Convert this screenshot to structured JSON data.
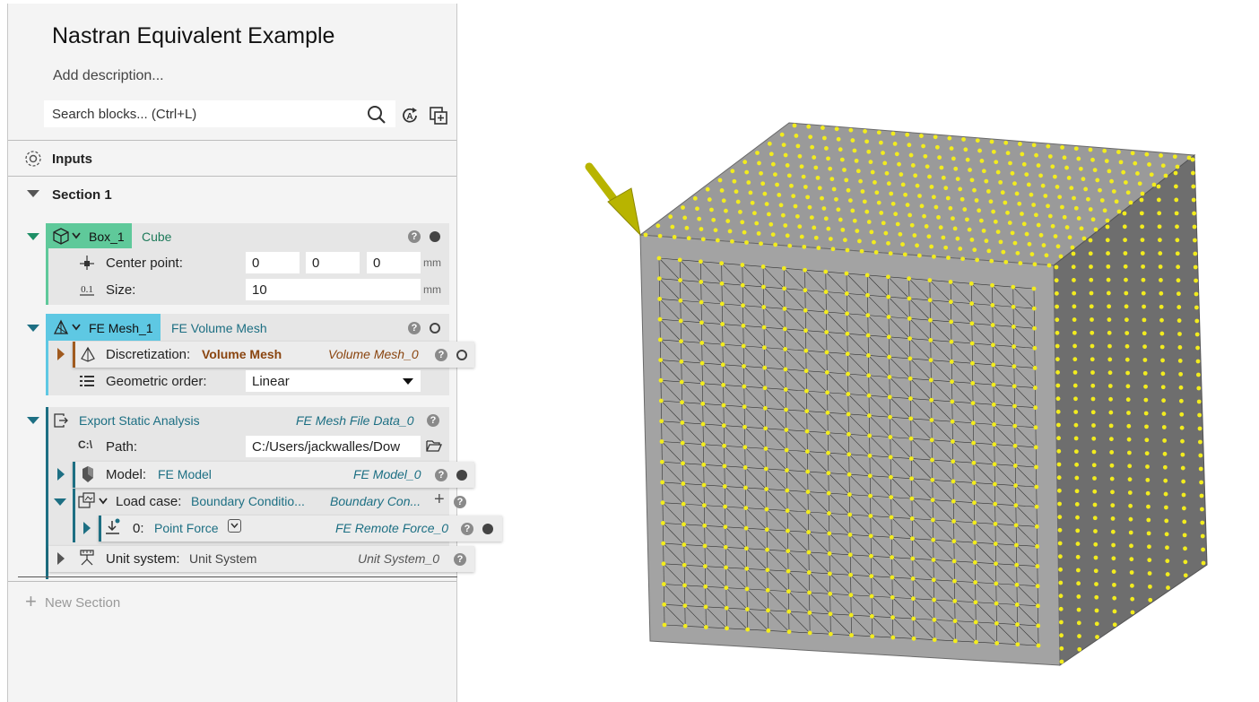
{
  "header": {
    "title": "Nastran Equivalent Example",
    "description_placeholder": "Add description...",
    "search_placeholder": "Search blocks... (Ctrl+L)"
  },
  "inputs": {
    "label": "Inputs"
  },
  "section": {
    "label": "Section 1",
    "new_section_label": "New Section"
  },
  "box_block": {
    "name": "Box_1",
    "type": "Cube",
    "center_label": "Center point:",
    "center_values": [
      "0",
      "0",
      "0"
    ],
    "center_unit": "mm",
    "size_label": "Size:",
    "size_value": "10",
    "size_unit": "mm",
    "color": "#5fc99a"
  },
  "mesh_block": {
    "name": "FE Mesh_1",
    "type": "FE Volume Mesh",
    "discretization_label": "Discretization:",
    "discretization_value": "Volume Mesh",
    "discretization_ref": "Volume Mesh_0",
    "order_label": "Geometric order:",
    "order_value": "Linear",
    "color": "#5ec8e3"
  },
  "export_block": {
    "name": "Export Static Analysis",
    "ref": "FE Mesh File Data_0",
    "path_label": "Path:",
    "path_value": "C:/Users/jackwalles/Dow",
    "model_label": "Model:",
    "model_value": "FE Model",
    "model_ref": "FE Model_0",
    "loadcase_label": "Load case:",
    "loadcase_value": "Boundary Conditio...",
    "loadcase_ref": "Boundary Con...",
    "force_index": "0:",
    "force_value": "Point Force",
    "force_ref": "FE Remote Force_0",
    "unit_label": "Unit system:",
    "unit_value": "Unit System",
    "unit_ref": "Unit System_0"
  },
  "viewport": {
    "cube_color": "#a3a3a3",
    "node_color": "#f2ec1e",
    "arrow_color": "#b8b400"
  }
}
